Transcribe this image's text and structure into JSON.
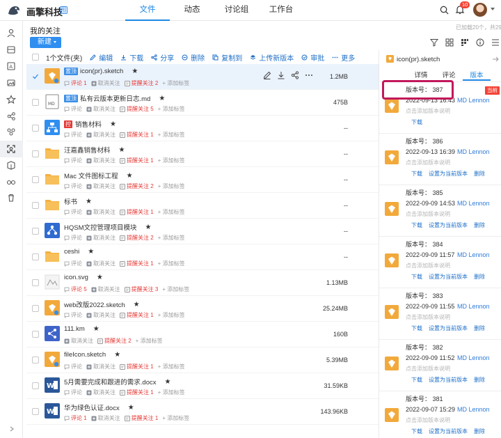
{
  "brand": {
    "name": "画擎科技",
    "badge": "图"
  },
  "nav": {
    "items": [
      "文件",
      "动态",
      "讨论组",
      "工作台"
    ],
    "active": 0
  },
  "notifications": {
    "count": "10"
  },
  "page": {
    "title": "我的关注",
    "loaded_info": "已加载20个，共29个",
    "new_button": "新建"
  },
  "actionbar": {
    "selected_count": "1个文件(夹)",
    "actions": [
      "编辑",
      "下载",
      "分享",
      "删除",
      "复制到",
      "上传新版本",
      "审批",
      "更多"
    ]
  },
  "files": [
    {
      "name": "icon(pr).sketch",
      "pinned": "置顶",
      "meta": [
        "评论 1",
        "取消关注",
        "提醒关注 2",
        "+ 添加标签"
      ],
      "size": "1.2MB",
      "thumb": "sketch"
    },
    {
      "name": "私有云版本更新日志.md",
      "pinned": "置顶",
      "meta": [
        "评论",
        "取消关注",
        "提醒关注 5",
        "+ 添加标签"
      ],
      "size": "475B",
      "thumb": "md"
    },
    {
      "name": "销售材料",
      "ctrl": "控",
      "meta": [
        "评论",
        "取消关注",
        "提醒关注 1",
        "+ 添加标签"
      ],
      "size": "--",
      "thumb": "org"
    },
    {
      "name": "汪嘉鑫销售材料",
      "meta": [
        "评论",
        "取消关注",
        "提醒关注 1",
        "+ 添加标签"
      ],
      "size": "--",
      "thumb": "folder"
    },
    {
      "name": "Mac 文件图标工程",
      "meta": [
        "评论",
        "取消关注",
        "提醒关注 2",
        "+ 添加标签"
      ],
      "size": "--",
      "thumb": "folder"
    },
    {
      "name": "标书",
      "meta": [
        "评论",
        "取消关注",
        "提醒关注 1",
        "+ 添加标签"
      ],
      "size": "--",
      "thumb": "folder"
    },
    {
      "name": "HQSM文控管理项目模块",
      "meta": [
        "评论",
        "取消关注",
        "提醒关注 2",
        "+ 添加标签"
      ],
      "size": "--",
      "thumb": "net"
    },
    {
      "name": "ceshi",
      "meta": [
        "评论",
        "取消关注",
        "提醒关注 1",
        "+ 添加标签"
      ],
      "size": "--",
      "thumb": "folder"
    },
    {
      "name": "icon.svg",
      "meta": [
        "评论 5",
        "取消关注",
        "提醒关注 3",
        "+ 添加标签"
      ],
      "size": "1.13MB",
      "thumb": "svg"
    },
    {
      "name": "web改版2022.sketch",
      "meta": [
        "评论",
        "取消关注",
        "提醒关注 1",
        "+ 添加标签"
      ],
      "size": "25.24MB",
      "thumb": "sketch"
    },
    {
      "name": "111.km",
      "meta": [
        "取消关注",
        "提醒关注 2",
        "+ 添加标签"
      ],
      "size": "160B",
      "thumb": "km"
    },
    {
      "name": "fileIcon.sketch",
      "meta": [
        "评论",
        "取消关注",
        "提醒关注 1",
        "+ 添加标签"
      ],
      "size": "5.39MB",
      "thumb": "sketch"
    },
    {
      "name": "5月需要完成和跟进的需求.docx",
      "meta": [
        "评论",
        "取消关注",
        "提醒关注 1",
        "+ 添加标签"
      ],
      "size": "31.59KB",
      "thumb": "docx"
    },
    {
      "name": "华为绿色认证.docx",
      "meta": [
        "评论 1",
        "取消关注",
        "提醒关注 1",
        "+ 添加标签"
      ],
      "size": "143.96KB",
      "thumb": "docx"
    }
  ],
  "panel": {
    "file_name": "icon(pr).sketch",
    "tabs": [
      "详情",
      "评论",
      "版本"
    ],
    "active_tab": 2,
    "versions": [
      {
        "label": "版本号：",
        "number": "387",
        "time": "2022-09-13 16:43",
        "user": "MD Lennon",
        "desc": "点击添加版本说明",
        "links": [
          "下载"
        ],
        "current": "当前"
      },
      {
        "label": "版本号：",
        "number": "386",
        "time": "2022-09-13 16:39",
        "user": "MD Lennon",
        "desc": "点击添加版本说明",
        "links": [
          "下载",
          "设置为当前版本",
          "删除"
        ]
      },
      {
        "label": "版本号：",
        "number": "385",
        "time": "2022-09-09 14:53",
        "user": "MD Lennon",
        "desc": "点击添加版本说明",
        "links": [
          "下载",
          "设置为当前版本",
          "删除"
        ]
      },
      {
        "label": "版本号：",
        "number": "384",
        "time": "2022-09-09 11:57",
        "user": "MD Lennon",
        "desc": "点击添加版本说明",
        "links": [
          "下载",
          "设置为当前版本",
          "删除"
        ]
      },
      {
        "label": "版本号：",
        "number": "383",
        "time": "2022-09-09 11:55",
        "user": "MD Lennon",
        "desc": "点击添加版本说明",
        "links": [
          "下载",
          "设置为当前版本",
          "删除"
        ]
      },
      {
        "label": "版本号：",
        "number": "382",
        "time": "2022-09-09 11:52",
        "user": "MD Lennon",
        "desc": "点击添加版本说明",
        "links": [
          "下载",
          "设置为当前版本",
          "删除"
        ]
      },
      {
        "label": "版本号：",
        "number": "381",
        "time": "2022-09-07 15:29",
        "user": "MD Lennon",
        "desc": "点击添加版本说明",
        "links": [
          "下载",
          "设置为当前版本",
          "删除"
        ]
      }
    ]
  },
  "colors": {
    "accent": "#1e88e5",
    "folder": "#f5b041",
    "sketch": "#f2a93b",
    "danger": "#e53935"
  }
}
